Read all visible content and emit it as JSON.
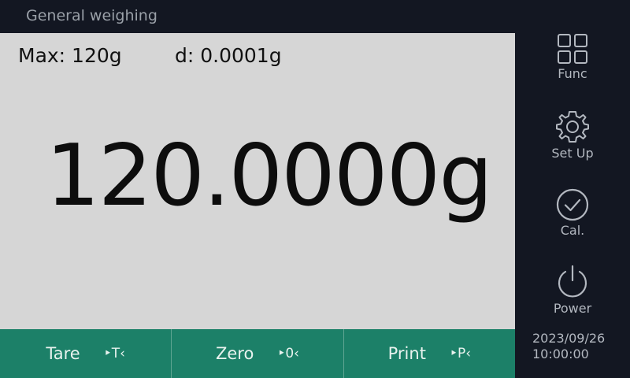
{
  "window": {
    "title": "General weighing"
  },
  "specs": {
    "max_label": "Max: 120g",
    "division_label": "d: 0.0001g"
  },
  "display": {
    "reading": "120.0000g"
  },
  "keys": [
    {
      "label": "Tare",
      "shortcut": "‣T‹"
    },
    {
      "label": "Zero",
      "shortcut": "‣0‹"
    },
    {
      "label": "Print",
      "shortcut": "‣P‹"
    }
  ],
  "sidebar": {
    "items": [
      {
        "label": "Func",
        "icon": "grid-icon"
      },
      {
        "label": "Set Up",
        "icon": "gear-icon"
      },
      {
        "label": "Cal.",
        "icon": "check-circle-icon"
      },
      {
        "label": "Power",
        "icon": "power-icon"
      }
    ]
  },
  "status": {
    "date": "2023/09/26",
    "time": "10:00:00"
  },
  "colors": {
    "background": "#131722",
    "display": "#d6d6d6",
    "keybar": "#1c8068",
    "icon": "#b3b8c0"
  }
}
